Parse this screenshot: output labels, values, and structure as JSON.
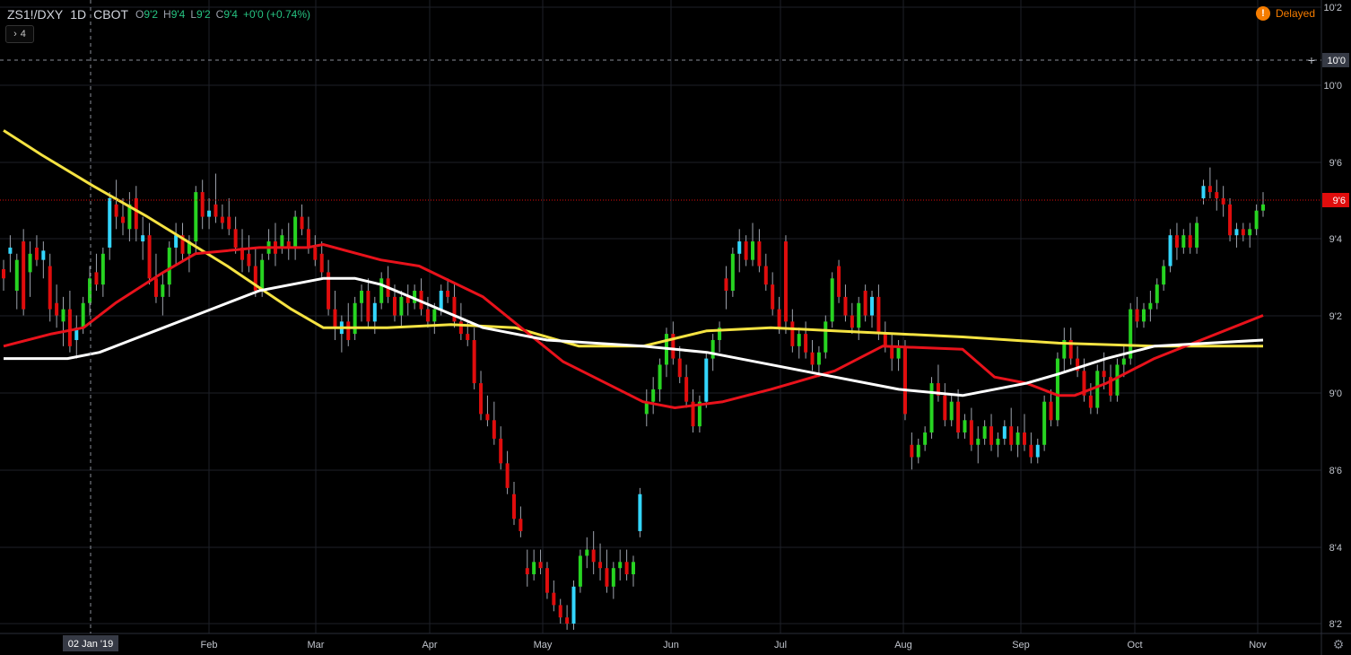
{
  "header": {
    "symbol": "ZS1!/DXY",
    "interval": "1D",
    "exchange": "CBOT",
    "open_key": "O",
    "open_val": "9'2",
    "high_key": "H",
    "high_val": "9'4",
    "low_key": "L",
    "low_val": "9'2",
    "close_key": "C",
    "close_val": "9'4",
    "change": "+0'0 (+0.74%)"
  },
  "indicators_toggle": {
    "label": "4"
  },
  "status": {
    "delayed_label": "Delayed"
  },
  "colors": {
    "up": "#27d421",
    "down": "#e00d0d",
    "up_hollow": "#33d6ff",
    "ma_yellow": "#f5e342",
    "ma_red": "#e8121b",
    "ma_white": "#ffffff",
    "grid": "#1e2028",
    "axis_text": "#c0c4cc"
  },
  "chart_data": {
    "type": "candlestick",
    "title": "",
    "x_labels": [
      "Feb",
      "Mar",
      "Apr",
      "May",
      "Jun",
      "Jul",
      "Aug",
      "Sep",
      "Oct",
      "Nov"
    ],
    "crosshair_date_label": "02 Jan '19",
    "crosshair_price_label": "10'0",
    "last_price_label": "9'6",
    "y_tick_labels": [
      "10'2",
      "10'0",
      "9'6",
      "9'4",
      "9'2",
      "9'0",
      "8'6",
      "8'4",
      "8'2"
    ],
    "y_range": [
      8.2,
      10.2
    ],
    "last_price": 9.6,
    "candles": [
      [
        9.35,
        9.38,
        9.28,
        9.32
      ],
      [
        9.4,
        9.46,
        9.34,
        9.42
      ],
      [
        9.28,
        9.4,
        9.22,
        9.38
      ],
      [
        9.44,
        9.48,
        9.2,
        9.22
      ],
      [
        9.34,
        9.44,
        9.26,
        9.4
      ],
      [
        9.42,
        9.46,
        9.36,
        9.38
      ],
      [
        9.38,
        9.44,
        9.32,
        9.41
      ],
      [
        9.36,
        9.4,
        9.18,
        9.22
      ],
      [
        9.24,
        9.3,
        9.16,
        9.2
      ],
      [
        9.18,
        9.26,
        9.1,
        9.22
      ],
      [
        9.22,
        9.28,
        9.08,
        9.1
      ],
      [
        9.12,
        9.2,
        9.06,
        9.16
      ],
      [
        9.16,
        9.26,
        9.14,
        9.24
      ],
      [
        9.24,
        9.36,
        9.2,
        9.32
      ],
      [
        9.34,
        9.4,
        9.28,
        9.3
      ],
      [
        9.3,
        9.42,
        9.26,
        9.4
      ],
      [
        9.42,
        9.6,
        9.38,
        9.58
      ],
      [
        9.56,
        9.64,
        9.48,
        9.52
      ],
      [
        9.52,
        9.58,
        9.46,
        9.5
      ],
      [
        9.48,
        9.6,
        9.44,
        9.56
      ],
      [
        9.58,
        9.62,
        9.44,
        9.48
      ],
      [
        9.44,
        9.52,
        9.38,
        9.46
      ],
      [
        9.46,
        9.5,
        9.3,
        9.32
      ],
      [
        9.32,
        9.4,
        9.24,
        9.26
      ],
      [
        9.26,
        9.34,
        9.2,
        9.3
      ],
      [
        9.3,
        9.44,
        9.26,
        9.42
      ],
      [
        9.42,
        9.5,
        9.36,
        9.46
      ],
      [
        9.46,
        9.5,
        9.38,
        9.4
      ],
      [
        9.4,
        9.46,
        9.34,
        9.44
      ],
      [
        9.44,
        9.62,
        9.4,
        9.6
      ],
      [
        9.6,
        9.64,
        9.48,
        9.52
      ],
      [
        9.52,
        9.58,
        9.48,
        9.54
      ],
      [
        9.56,
        9.66,
        9.5,
        9.52
      ],
      [
        9.52,
        9.56,
        9.48,
        9.5
      ],
      [
        9.52,
        9.58,
        9.46,
        9.48
      ],
      [
        9.48,
        9.52,
        9.4,
        9.42
      ],
      [
        9.42,
        9.48,
        9.34,
        9.38
      ],
      [
        9.4,
        9.46,
        9.34,
        9.36
      ],
      [
        9.36,
        9.42,
        9.26,
        9.28
      ],
      [
        9.28,
        9.4,
        9.26,
        9.38
      ],
      [
        9.4,
        9.48,
        9.38,
        9.44
      ],
      [
        9.44,
        9.5,
        9.36,
        9.4
      ],
      [
        9.42,
        9.48,
        9.4,
        9.46
      ],
      [
        9.44,
        9.5,
        9.38,
        9.42
      ],
      [
        9.42,
        9.54,
        9.38,
        9.52
      ],
      [
        9.52,
        9.56,
        9.46,
        9.48
      ],
      [
        9.48,
        9.52,
        9.4,
        9.42
      ],
      [
        9.42,
        9.46,
        9.36,
        9.38
      ],
      [
        9.4,
        9.44,
        9.32,
        9.34
      ],
      [
        9.34,
        9.38,
        9.2,
        9.22
      ],
      [
        9.22,
        9.28,
        9.12,
        9.16
      ],
      [
        9.14,
        9.2,
        9.08,
        9.18
      ],
      [
        9.18,
        9.24,
        9.1,
        9.12
      ],
      [
        9.14,
        9.26,
        9.12,
        9.24
      ],
      [
        9.24,
        9.3,
        9.18,
        9.28
      ],
      [
        9.28,
        9.32,
        9.16,
        9.18
      ],
      [
        9.18,
        9.26,
        9.14,
        9.24
      ],
      [
        9.24,
        9.34,
        9.22,
        9.32
      ],
      [
        9.32,
        9.36,
        9.24,
        9.26
      ],
      [
        9.26,
        9.3,
        9.18,
        9.2
      ],
      [
        9.2,
        9.28,
        9.16,
        9.26
      ],
      [
        9.26,
        9.3,
        9.2,
        9.24
      ],
      [
        9.24,
        9.3,
        9.22,
        9.28
      ],
      [
        9.28,
        9.32,
        9.2,
        9.22
      ],
      [
        9.22,
        9.26,
        9.16,
        9.18
      ],
      [
        9.18,
        9.24,
        9.14,
        9.22
      ],
      [
        9.22,
        9.3,
        9.2,
        9.28
      ],
      [
        9.28,
        9.32,
        9.24,
        9.26
      ],
      [
        9.26,
        9.3,
        9.16,
        9.18
      ],
      [
        9.18,
        9.24,
        9.12,
        9.14
      ],
      [
        9.14,
        9.18,
        9.1,
        9.12
      ],
      [
        9.12,
        9.16,
        8.96,
        8.98
      ],
      [
        8.98,
        9.02,
        8.86,
        8.88
      ],
      [
        8.88,
        8.94,
        8.84,
        8.86
      ],
      [
        8.86,
        8.92,
        8.78,
        8.8
      ],
      [
        8.8,
        8.84,
        8.7,
        8.72
      ],
      [
        8.72,
        8.76,
        8.62,
        8.64
      ],
      [
        8.62,
        8.66,
        8.52,
        8.54
      ],
      [
        8.54,
        8.58,
        8.48,
        8.5
      ],
      [
        8.38,
        8.44,
        8.32,
        8.36
      ],
      [
        8.36,
        8.44,
        8.34,
        8.4
      ],
      [
        8.4,
        8.44,
        8.36,
        8.38
      ],
      [
        8.38,
        8.4,
        8.28,
        8.3
      ],
      [
        8.3,
        8.34,
        8.24,
        8.26
      ],
      [
        8.26,
        8.28,
        8.2,
        8.22
      ],
      [
        8.22,
        8.26,
        8.18,
        8.2
      ],
      [
        8.2,
        8.34,
        8.18,
        8.32
      ],
      [
        8.32,
        8.44,
        8.3,
        8.42
      ],
      [
        8.42,
        8.48,
        8.38,
        8.44
      ],
      [
        8.44,
        8.5,
        8.36,
        8.4
      ],
      [
        8.4,
        8.46,
        8.34,
        8.38
      ],
      [
        8.38,
        8.44,
        8.3,
        8.32
      ],
      [
        8.32,
        8.4,
        8.28,
        8.38
      ],
      [
        8.38,
        8.44,
        8.34,
        8.4
      ],
      [
        8.4,
        8.44,
        8.34,
        8.36
      ],
      [
        8.36,
        8.42,
        8.32,
        8.4
      ],
      [
        8.5,
        8.64,
        8.48,
        8.62
      ],
      [
        8.88,
        8.96,
        8.84,
        8.92
      ],
      [
        8.92,
        9.0,
        8.88,
        8.96
      ],
      [
        8.96,
        9.06,
        8.92,
        9.04
      ],
      [
        9.04,
        9.16,
        9.0,
        9.14
      ],
      [
        9.14,
        9.18,
        9.04,
        9.06
      ],
      [
        9.06,
        9.1,
        8.98,
        9.0
      ],
      [
        9.0,
        9.04,
        8.9,
        8.92
      ],
      [
        8.92,
        8.96,
        8.82,
        8.84
      ],
      [
        8.84,
        8.94,
        8.82,
        8.92
      ],
      [
        8.92,
        9.08,
        8.9,
        9.06
      ],
      [
        9.06,
        9.14,
        9.02,
        9.12
      ],
      [
        9.12,
        9.18,
        9.08,
        9.16
      ],
      [
        9.32,
        9.36,
        9.22,
        9.28
      ],
      [
        9.28,
        9.42,
        9.26,
        9.4
      ],
      [
        9.4,
        9.48,
        9.34,
        9.44
      ],
      [
        9.44,
        9.46,
        9.36,
        9.38
      ],
      [
        9.38,
        9.5,
        9.36,
        9.44
      ],
      [
        9.44,
        9.48,
        9.34,
        9.36
      ],
      [
        9.36,
        9.4,
        9.28,
        9.3
      ],
      [
        9.3,
        9.34,
        9.2,
        9.22
      ],
      [
        9.22,
        9.26,
        9.14,
        9.16
      ],
      [
        9.44,
        9.46,
        9.14,
        9.18
      ],
      [
        9.18,
        9.22,
        9.08,
        9.1
      ],
      [
        9.1,
        9.16,
        9.06,
        9.14
      ],
      [
        9.14,
        9.18,
        9.06,
        9.08
      ],
      [
        9.08,
        9.12,
        9.02,
        9.04
      ],
      [
        9.04,
        9.1,
        9.0,
        9.08
      ],
      [
        9.08,
        9.2,
        9.06,
        9.18
      ],
      [
        9.18,
        9.34,
        9.16,
        9.32
      ],
      [
        9.36,
        9.38,
        9.24,
        9.26
      ],
      [
        9.26,
        9.3,
        9.18,
        9.2
      ],
      [
        9.2,
        9.24,
        9.14,
        9.16
      ],
      [
        9.16,
        9.26,
        9.12,
        9.24
      ],
      [
        9.28,
        9.3,
        9.18,
        9.2
      ],
      [
        9.2,
        9.28,
        9.16,
        9.26
      ],
      [
        9.26,
        9.3,
        9.12,
        9.14
      ],
      [
        9.14,
        9.18,
        9.08,
        9.1
      ],
      [
        9.1,
        9.14,
        9.02,
        9.06
      ],
      [
        9.06,
        9.12,
        9.02,
        9.1
      ],
      [
        9.1,
        9.12,
        8.86,
        8.88
      ],
      [
        8.78,
        8.82,
        8.7,
        8.74
      ],
      [
        8.74,
        8.8,
        8.72,
        8.78
      ],
      [
        8.78,
        8.84,
        8.76,
        8.82
      ],
      [
        8.82,
        9.0,
        8.8,
        8.98
      ],
      [
        8.98,
        9.04,
        8.92,
        8.94
      ],
      [
        8.94,
        8.98,
        8.84,
        8.86
      ],
      [
        8.86,
        8.94,
        8.84,
        8.92
      ],
      [
        8.92,
        8.96,
        8.8,
        8.82
      ],
      [
        8.82,
        8.88,
        8.8,
        8.86
      ],
      [
        8.86,
        8.9,
        8.76,
        8.78
      ],
      [
        8.78,
        8.84,
        8.72,
        8.8
      ],
      [
        8.8,
        8.86,
        8.78,
        8.84
      ],
      [
        8.84,
        8.88,
        8.76,
        8.78
      ],
      [
        8.78,
        8.82,
        8.74,
        8.8
      ],
      [
        8.8,
        8.86,
        8.78,
        8.84
      ],
      [
        8.84,
        8.9,
        8.76,
        8.78
      ],
      [
        8.78,
        8.84,
        8.74,
        8.82
      ],
      [
        8.82,
        8.88,
        8.76,
        8.78
      ],
      [
        8.78,
        8.82,
        8.72,
        8.74
      ],
      [
        8.74,
        8.8,
        8.72,
        8.78
      ],
      [
        8.78,
        8.94,
        8.76,
        8.92
      ],
      [
        8.92,
        8.96,
        8.84,
        8.86
      ],
      [
        8.86,
        9.08,
        8.84,
        9.06
      ],
      [
        9.06,
        9.16,
        9.02,
        9.12
      ],
      [
        9.12,
        9.16,
        9.04,
        9.06
      ],
      [
        9.06,
        9.1,
        9.0,
        9.02
      ],
      [
        9.02,
        9.06,
        8.92,
        8.94
      ],
      [
        8.94,
        8.98,
        8.88,
        8.9
      ],
      [
        8.9,
        9.04,
        8.88,
        9.02
      ],
      [
        9.02,
        9.08,
        8.96,
        9.0
      ],
      [
        9.0,
        9.04,
        8.92,
        8.94
      ],
      [
        8.94,
        9.06,
        8.92,
        9.04
      ],
      [
        9.04,
        9.1,
        9.0,
        9.06
      ],
      [
        9.06,
        9.24,
        9.04,
        9.22
      ],
      [
        9.22,
        9.26,
        9.16,
        9.18
      ],
      [
        9.18,
        9.24,
        9.16,
        9.22
      ],
      [
        9.22,
        9.28,
        9.18,
        9.24
      ],
      [
        9.24,
        9.32,
        9.22,
        9.3
      ],
      [
        9.3,
        9.38,
        9.28,
        9.36
      ],
      [
        9.36,
        9.48,
        9.34,
        9.46
      ],
      [
        9.46,
        9.5,
        9.38,
        9.42
      ],
      [
        9.42,
        9.48,
        9.4,
        9.46
      ],
      [
        9.46,
        9.5,
        9.4,
        9.42
      ],
      [
        9.42,
        9.52,
        9.4,
        9.5
      ],
      [
        9.58,
        9.64,
        9.56,
        9.62
      ],
      [
        9.62,
        9.68,
        9.58,
        9.6
      ],
      [
        9.6,
        9.64,
        9.54,
        9.58
      ],
      [
        9.58,
        9.62,
        9.52,
        9.56
      ],
      [
        9.56,
        9.58,
        9.44,
        9.46
      ],
      [
        9.46,
        9.5,
        9.42,
        9.48
      ],
      [
        9.48,
        9.5,
        9.44,
        9.46
      ],
      [
        9.46,
        9.5,
        9.42,
        9.48
      ],
      [
        9.48,
        9.56,
        9.46,
        9.54
      ],
      [
        9.54,
        9.6,
        9.52,
        9.56
      ]
    ],
    "series": [
      {
        "name": "",
        "color": "#f5e342",
        "x": [
          0,
          12,
          28,
          45,
          70,
          90,
          100,
          120,
          140,
          160,
          180,
          200,
          220,
          240,
          260,
          280,
          300,
          330,
          360,
          394
        ],
        "y": [
          9.8,
          9.72,
          9.62,
          9.52,
          9.36,
          9.22,
          9.16,
          9.16,
          9.17,
          9.16,
          9.1,
          9.1,
          9.15,
          9.16,
          9.15,
          9.14,
          9.13,
          9.11,
          9.1,
          9.1
        ]
      },
      {
        "name": "",
        "color": "#e8121b",
        "x": [
          0,
          15,
          25,
          35,
          50,
          60,
          80,
          95,
          100,
          118,
          130,
          150,
          175,
          200,
          210,
          225,
          240,
          260,
          275,
          300,
          310,
          320,
          330,
          335,
          345,
          360,
          394
        ],
        "y": [
          9.1,
          9.14,
          9.16,
          9.24,
          9.34,
          9.4,
          9.42,
          9.42,
          9.43,
          9.38,
          9.36,
          9.26,
          9.05,
          8.92,
          8.9,
          8.92,
          8.96,
          9.02,
          9.1,
          9.09,
          9.0,
          8.98,
          8.94,
          8.94,
          8.98,
          9.06,
          9.2
        ]
      },
      {
        "name": "",
        "color": "#ffffff",
        "x": [
          0,
          20,
          30,
          50,
          65,
          80,
          100,
          110,
          118,
          125,
          150,
          170,
          200,
          220,
          250,
          280,
          300,
          320,
          330,
          345,
          360,
          394
        ],
        "y": [
          9.06,
          9.06,
          9.08,
          9.16,
          9.22,
          9.28,
          9.32,
          9.32,
          9.3,
          9.27,
          9.16,
          9.12,
          9.1,
          9.08,
          9.02,
          8.96,
          8.94,
          8.98,
          9.01,
          9.06,
          9.1,
          9.12
        ]
      }
    ]
  }
}
